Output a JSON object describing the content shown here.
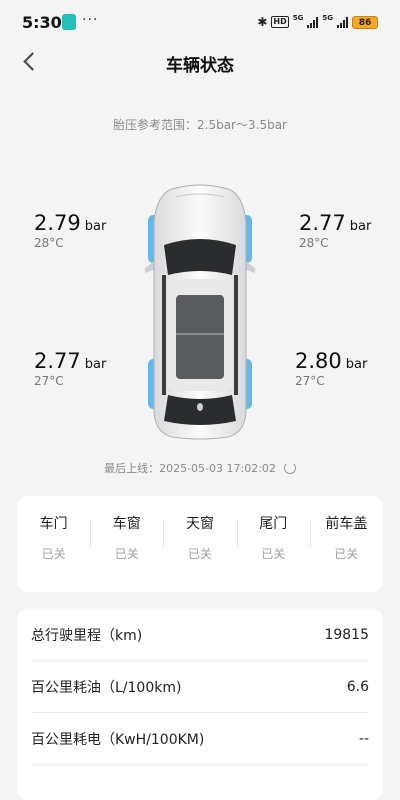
{
  "status_bar": {
    "time": "5:30",
    "dots": "···",
    "hd": "HD",
    "net1": "5G",
    "net2": "5G",
    "battery": "86"
  },
  "nav": {
    "title": "车辆状态"
  },
  "pressure_range": "胎压参考范围：2.5bar～3.5bar",
  "tires": {
    "front_left": {
      "pressure": "2.79",
      "unit": "bar",
      "temp": "28°C"
    },
    "front_right": {
      "pressure": "2.77",
      "unit": "bar",
      "temp": "28°C"
    },
    "rear_left": {
      "pressure": "2.77",
      "unit": "bar",
      "temp": "27°C"
    },
    "rear_right": {
      "pressure": "2.80",
      "unit": "bar",
      "temp": "27°C"
    }
  },
  "last_online": "最后上线：2025-05-03 17:02:02",
  "doors": [
    {
      "label": "车门",
      "state": "已关"
    },
    {
      "label": "车窗",
      "state": "已关"
    },
    {
      "label": "天窗",
      "state": "已关"
    },
    {
      "label": "尾门",
      "state": "已关"
    },
    {
      "label": "前车盖",
      "state": "已关"
    }
  ],
  "stats": [
    {
      "label": "总行驶里程（km)",
      "value": "19815"
    },
    {
      "label": "百公里耗油（L/100km)",
      "value": "6.6"
    },
    {
      "label": "百公里耗电（KwH/100KM)",
      "value": "--"
    }
  ],
  "colors": {
    "accent_tire": "#62b9ee",
    "bg": "#f4f4f5",
    "battery": "#f5a623"
  }
}
